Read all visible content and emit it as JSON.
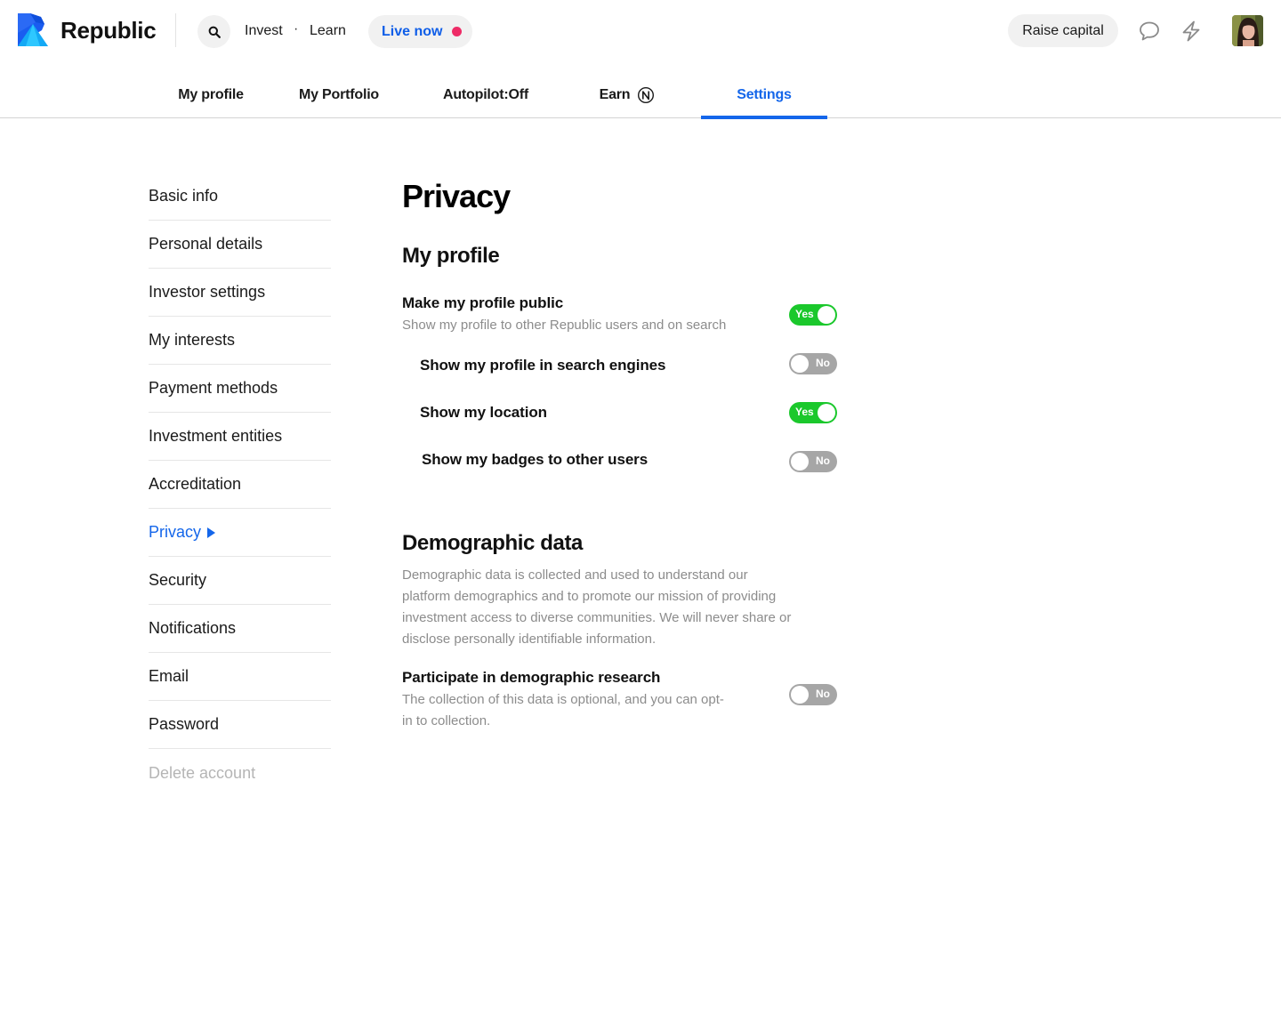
{
  "header": {
    "brand": "Republic",
    "nav_links": [
      "Invest",
      "Learn"
    ],
    "nav_separator": "·",
    "live_label": "Live now",
    "raise_label": "Raise capital",
    "icons": {
      "search": "search-icon",
      "chat": "chat-bubble-icon",
      "activity": "lightning-icon"
    },
    "colors": {
      "brand": "#1466ea",
      "live_dot": "#ee2b66"
    }
  },
  "tabs": [
    {
      "label": "My profile",
      "active": false
    },
    {
      "label": "My Portfolio",
      "active": false
    },
    {
      "label": "Autopilot:Off",
      "active": false
    },
    {
      "label": "Earn",
      "active": false,
      "icon": "note-coin-icon"
    },
    {
      "label": "Settings",
      "active": true
    }
  ],
  "sidebar": {
    "items": [
      {
        "label": "Basic info"
      },
      {
        "label": "Personal details"
      },
      {
        "label": "Investor settings"
      },
      {
        "label": "My interests"
      },
      {
        "label": "Payment methods"
      },
      {
        "label": "Investment entities"
      },
      {
        "label": "Accreditation"
      },
      {
        "label": "Privacy",
        "active": true
      },
      {
        "label": "Security"
      },
      {
        "label": "Notifications"
      },
      {
        "label": "Email"
      },
      {
        "label": "Password"
      },
      {
        "label": "Delete account",
        "muted": true
      }
    ]
  },
  "main": {
    "title": "Privacy",
    "profile_section": {
      "title": "My profile",
      "settings": [
        {
          "label": "Make my profile public",
          "description": "Show my profile to other Republic users and on search",
          "value": true,
          "toggle_text": "Yes"
        },
        {
          "label": "Show my profile in search engines",
          "value": false,
          "toggle_text": "No"
        },
        {
          "label": "Show my location",
          "value": true,
          "toggle_text": "Yes"
        },
        {
          "label": "Show my badges to other users",
          "value": false,
          "toggle_text": "No"
        }
      ]
    },
    "demographic_section": {
      "title": "Demographic data",
      "description": "Demographic data is collected and used to understand our platform demographics and to promote our mission of providing investment access to diverse communities. We will never share or disclose personally identifiable information.",
      "settings": [
        {
          "label": "Participate in demographic research",
          "description": "The collection of this data is optional, and you can opt-in to collection.",
          "value": false,
          "toggle_text": "No"
        }
      ]
    }
  }
}
